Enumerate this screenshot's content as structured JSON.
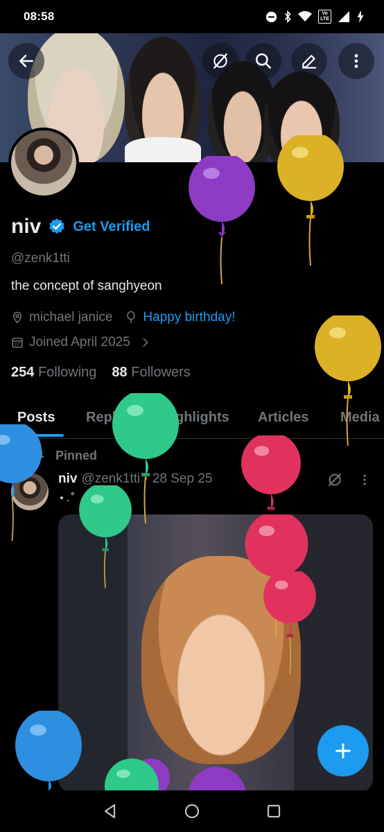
{
  "status_bar": {
    "time": "08:58",
    "network_badge": "LTE"
  },
  "header": {
    "icons": [
      "back-arrow-icon",
      "grok-icon",
      "search-icon",
      "edit-icon",
      "more-vertical-icon"
    ]
  },
  "profile": {
    "name": "niv",
    "verify_cta": "Get Verified",
    "handle": "@zenk1tti",
    "bio": "the concept of sanghyeon",
    "location": "michael janice",
    "birthday": "Happy birthday!",
    "joined": "Joined April 2025",
    "following_count": "254",
    "following_label": "Following",
    "followers_count": "88",
    "followers_label": "Followers"
  },
  "tabs": [
    "Posts",
    "Replies",
    "Highlights",
    "Articles",
    "Media"
  ],
  "post": {
    "pinned_label": "Pinned",
    "author": "niv",
    "handle": "@zenk1tti",
    "date": "· 28 Sep 25",
    "text": "⋆.˚ ✧ ˚.⋆"
  },
  "colors": {
    "accent": "#1d9bf0",
    "background": "#000000",
    "muted": "#71767b"
  }
}
